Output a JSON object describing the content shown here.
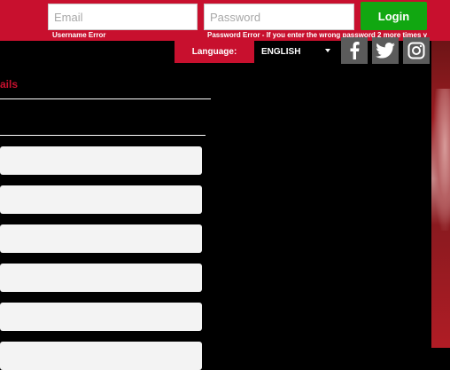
{
  "login": {
    "email_placeholder": "Email",
    "password_placeholder": "Password",
    "username_error": "Username Error",
    "password_error": "Password Error - If you enter the wrong password 2 more times y",
    "login_label": "Login"
  },
  "language": {
    "label": "Language:",
    "selected": "ENGLISH"
  },
  "social": {
    "facebook": "facebook-icon",
    "twitter": "twitter-icon",
    "instagram": "instagram-icon"
  },
  "form": {
    "section_title": "ails"
  },
  "colors": {
    "brand_red": "#c8102e",
    "login_green": "#11a711",
    "social_gray": "#5b5b5b",
    "background": "#000000"
  }
}
